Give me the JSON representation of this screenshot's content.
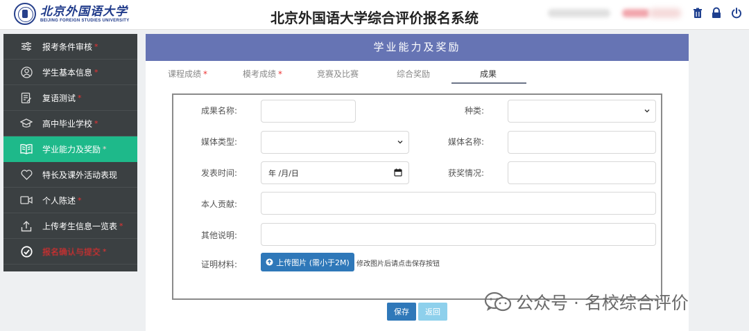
{
  "header": {
    "logo_cn": "北京外国语大学",
    "logo_en": "BEIJING FOREIGN STUDIES UNIVERSITY",
    "title": "北京外国语大学综合评价报名系统",
    "icons": [
      "trash-icon",
      "lock-icon",
      "power-icon"
    ]
  },
  "sidebar": {
    "items": [
      {
        "label": "报考条件审核",
        "required": true,
        "icon": "sliders-icon"
      },
      {
        "label": "学生基本信息",
        "required": true,
        "icon": "user-circle-icon"
      },
      {
        "label": "复语测试",
        "required": true,
        "icon": "edit-doc-icon"
      },
      {
        "label": "高中毕业学校",
        "required": true,
        "icon": "graduation-cap-icon"
      },
      {
        "label": "学业能力及奖励",
        "required": true,
        "icon": "book-icon",
        "active": true
      },
      {
        "label": "特长及课外活动表现",
        "required": false,
        "icon": "heart-icon"
      },
      {
        "label": "个人陈述",
        "required": true,
        "icon": "video-icon"
      },
      {
        "label": "上传考生信息一览表",
        "required": true,
        "icon": "upload-icon"
      },
      {
        "label": "报名确认与提交",
        "required": true,
        "icon": "check-circle-icon",
        "warn": true
      }
    ]
  },
  "main": {
    "banner_title": "学业能力及奖励",
    "tabs": [
      {
        "label": "课程成绩",
        "required": true
      },
      {
        "label": "模考成绩",
        "required": true
      },
      {
        "label": "竞赛及比赛",
        "required": false
      },
      {
        "label": "综合奖励",
        "required": false
      },
      {
        "label": "成果",
        "required": false,
        "active": true
      }
    ],
    "form": {
      "achievement_name_label": "成果名称:",
      "category_label": "种类:",
      "media_type_label": "媒体类型:",
      "media_name_label": "媒体名称:",
      "publish_time_label": "发表时间:",
      "publish_time_placeholder": "年 /月/日",
      "award_label": "获奖情况:",
      "contribution_label": "本人贡献:",
      "other_label": "其他说明:",
      "proof_label": "证明材料:",
      "upload_label": "上传图片 (需小于2M)",
      "hint": "修改图片后请点击保存按钮"
    },
    "save_label": "保存",
    "back_label": "返回"
  },
  "watermark": {
    "text": "公众号 · 名校综合评价"
  },
  "colors": {
    "sidebar_bg": "#3b4042",
    "sidebar_active": "#1eb98a",
    "banner": "#6674b4",
    "primary_button": "#2f78b9",
    "secondary_button": "#8ed0ec",
    "required_star": "#e33333"
  }
}
